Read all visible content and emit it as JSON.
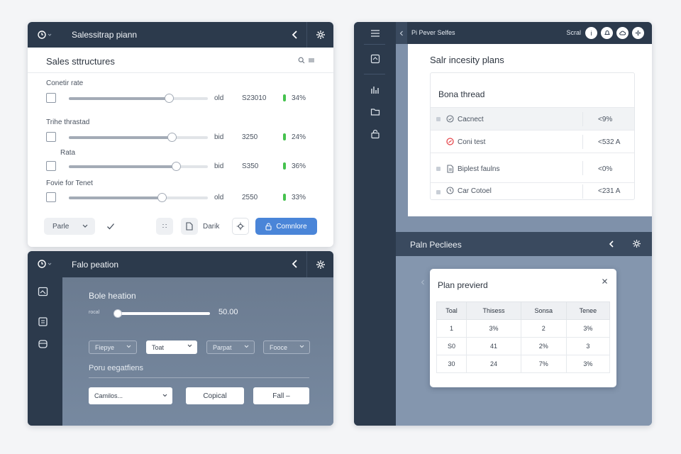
{
  "panel_a": {
    "title": "Salessitrap piann",
    "section_title": "Sales sttructures",
    "rows": [
      {
        "label": "Conetir rate",
        "level": 0.72,
        "unit": "old",
        "value": "S23010",
        "pct": "34%"
      },
      {
        "label": "Trihe thrastad",
        "level": 0.74,
        "unit": "bid",
        "value": "3250",
        "pct": "24%"
      },
      {
        "label": "Rata",
        "level": 0.77,
        "unit": "bid",
        "value": "S350",
        "pct": "36%"
      },
      {
        "label": "Fovie for Tenet",
        "level": 0.67,
        "unit": "old",
        "value": "2550",
        "pct": "33%"
      }
    ],
    "footer": {
      "select_label": "Parle",
      "mini_label": "∷",
      "mark_label": "Darik",
      "confirm_label": "Comnlore"
    }
  },
  "panel_b": {
    "title": "Falo peation",
    "heading": "Bole heation",
    "slider_label": "rocal",
    "slider_level": 0.0,
    "slider_value": "50.00",
    "dropdowns": [
      "Fiepye",
      "Toat",
      "Parpat",
      "Fooce"
    ],
    "subheading": "Poru eegatfiens",
    "select_value": "Camilos...",
    "btn_mid": "Copical",
    "btn_right": "Fall –"
  },
  "panel_c": {
    "top_title": "Pi Pever Selfes",
    "user_label": "Scral",
    "card_title": "Salr incesity plans",
    "inner_title": "Bona thread",
    "rows": [
      {
        "name": "Cacnect",
        "value": "<9%",
        "icon": "check-circle-icon",
        "color": "#6b7480"
      },
      {
        "name": "Coni test",
        "value": "<532 A",
        "icon": "alert-circle-icon",
        "color": "#e5484d"
      },
      {
        "name": "Biplest faulns",
        "value": "<0%",
        "icon": "document-icon",
        "color": "#6b7480"
      },
      {
        "name": "Car Cotoel",
        "value": "<231 A",
        "icon": "clock-icon",
        "color": "#6b7480"
      }
    ],
    "pp_title": "Paln Pecliees",
    "modal_title": "Plan previerd",
    "table_headers": [
      "Toal",
      "Thisess",
      "Sonsa",
      "Tenee"
    ],
    "table_rows": [
      [
        "1",
        "3%",
        "2",
        "3%"
      ],
      [
        "S0",
        "41",
        "2%",
        "3"
      ],
      [
        "30",
        "24",
        "7%",
        "3%"
      ]
    ]
  }
}
